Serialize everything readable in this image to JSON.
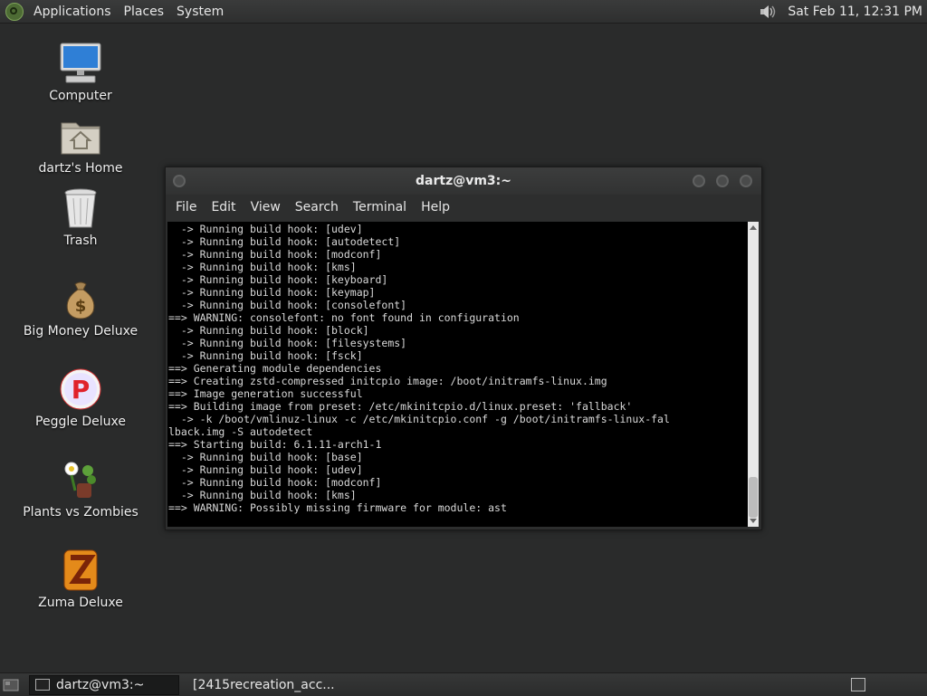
{
  "top_panel": {
    "menu": [
      "Applications",
      "Places",
      "System"
    ],
    "clock": "Sat Feb 11, 12:31 PM",
    "icons": {
      "logo": "distro-logo-icon",
      "volume": "volume-icon"
    }
  },
  "desktop": {
    "icons": [
      {
        "label": "Computer",
        "icon": "computer-icon"
      },
      {
        "label": "dartz's Home",
        "icon": "home-folder-icon"
      },
      {
        "label": "Trash",
        "icon": "trash-icon"
      },
      {
        "label": "Big Money Deluxe",
        "icon": "money-bag-icon"
      },
      {
        "label": "Peggle Deluxe",
        "icon": "peggle-icon"
      },
      {
        "label": "Plants vs Zombies",
        "icon": "plants-icon"
      },
      {
        "label": "Zuma Deluxe",
        "icon": "zuma-icon"
      }
    ]
  },
  "terminal": {
    "title": "dartz@vm3:~",
    "menu": [
      "File",
      "Edit",
      "View",
      "Search",
      "Terminal",
      "Help"
    ],
    "lines": [
      "  -> Running build hook: [udev]",
      "  -> Running build hook: [autodetect]",
      "  -> Running build hook: [modconf]",
      "  -> Running build hook: [kms]",
      "  -> Running build hook: [keyboard]",
      "  -> Running build hook: [keymap]",
      "  -> Running build hook: [consolefont]",
      "==> WARNING: consolefont: no font found in configuration",
      "  -> Running build hook: [block]",
      "  -> Running build hook: [filesystems]",
      "  -> Running build hook: [fsck]",
      "==> Generating module dependencies",
      "==> Creating zstd-compressed initcpio image: /boot/initramfs-linux.img",
      "==> Image generation successful",
      "==> Building image from preset: /etc/mkinitcpio.d/linux.preset: 'fallback'",
      "  -> -k /boot/vmlinuz-linux -c /etc/mkinitcpio.conf -g /boot/initramfs-linux-fal",
      "lback.img -S autodetect",
      "==> Starting build: 6.1.11-arch1-1",
      "  -> Running build hook: [base]",
      "  -> Running build hook: [udev]",
      "  -> Running build hook: [modconf]",
      "  -> Running build hook: [kms]",
      "==> WARNING: Possibly missing firmware for module: ast"
    ]
  },
  "taskbar": {
    "tasks": [
      {
        "label": "dartz@vm3:~",
        "icon": "terminal-icon",
        "active": true
      },
      {
        "label": "[2415recreation_acc...",
        "icon": "firefox-icon",
        "active": false
      }
    ],
    "icons": {
      "show_desktop": "show-desktop-icon",
      "workspace": "workspace-switcher-icon"
    }
  }
}
